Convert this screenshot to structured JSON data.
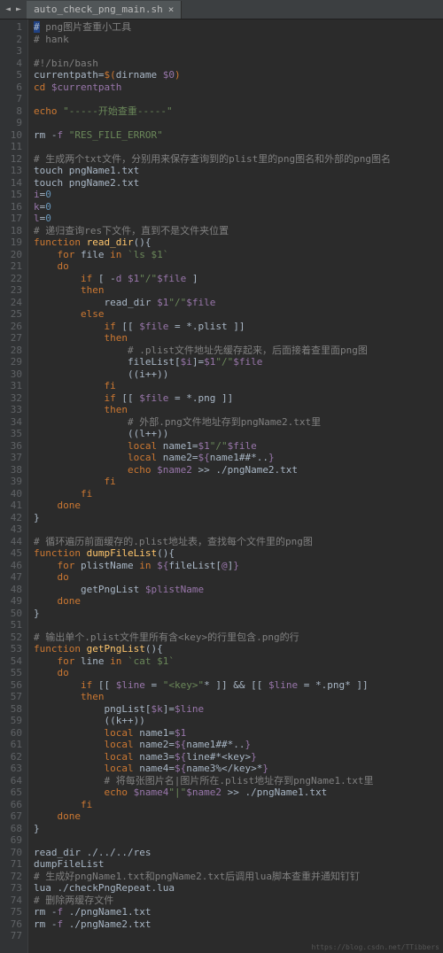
{
  "tab": {
    "name": "auto_check_png_main.sh",
    "close": "×"
  },
  "nav": {
    "left": "◄",
    "right": "►"
  },
  "watermark": "https://blog.csdn.net/TTibbers",
  "lines": [
    {
      "n": 1,
      "seg": [
        {
          "c": "c-hl",
          "t": "#"
        },
        {
          "c": "c-cmt",
          "t": " png图片查重小工具"
        }
      ]
    },
    {
      "n": 2,
      "seg": [
        {
          "c": "c-cmt",
          "t": "# hank"
        }
      ]
    },
    {
      "n": 3,
      "seg": []
    },
    {
      "n": 4,
      "seg": [
        {
          "c": "c-cmt",
          "t": "#!/bin/bash"
        }
      ]
    },
    {
      "n": 5,
      "seg": [
        {
          "c": "",
          "t": "currentpath"
        },
        {
          "c": "c-op",
          "t": "="
        },
        {
          "c": "c-kw",
          "t": "$("
        },
        {
          "c": "",
          "t": "dirname "
        },
        {
          "c": "c-var",
          "t": "$0"
        },
        {
          "c": "c-kw",
          "t": ")"
        }
      ]
    },
    {
      "n": 6,
      "seg": [
        {
          "c": "c-kw",
          "t": "cd "
        },
        {
          "c": "c-var",
          "t": "$currentpath"
        }
      ]
    },
    {
      "n": 7,
      "seg": []
    },
    {
      "n": 8,
      "seg": [
        {
          "c": "c-kw",
          "t": "echo "
        },
        {
          "c": "c-str",
          "t": "\"-----开始查重-----\""
        }
      ]
    },
    {
      "n": 9,
      "seg": []
    },
    {
      "n": 10,
      "seg": [
        {
          "c": "",
          "t": "rm "
        },
        {
          "c": "c-op",
          "t": "-"
        },
        {
          "c": "c-var",
          "t": "f "
        },
        {
          "c": "c-str",
          "t": "\"RES_FILE_ERROR\""
        }
      ]
    },
    {
      "n": 11,
      "seg": []
    },
    {
      "n": 12,
      "seg": [
        {
          "c": "c-cmt",
          "t": "# 生成两个txt文件，分别用来保存查询到的plist里的png图名和外部的png图名"
        }
      ]
    },
    {
      "n": 13,
      "seg": [
        {
          "c": "",
          "t": "touch pngName1.txt"
        }
      ]
    },
    {
      "n": 14,
      "seg": [
        {
          "c": "",
          "t": "touch pngName2.txt"
        }
      ]
    },
    {
      "n": 15,
      "seg": [
        {
          "c": "c-var",
          "t": "i"
        },
        {
          "c": "c-op",
          "t": "="
        },
        {
          "c": "c-num",
          "t": "0"
        }
      ]
    },
    {
      "n": 16,
      "seg": [
        {
          "c": "c-var",
          "t": "k"
        },
        {
          "c": "c-op",
          "t": "="
        },
        {
          "c": "c-num",
          "t": "0"
        }
      ]
    },
    {
      "n": 17,
      "seg": [
        {
          "c": "c-var",
          "t": "l"
        },
        {
          "c": "c-op",
          "t": "="
        },
        {
          "c": "c-num",
          "t": "0"
        }
      ]
    },
    {
      "n": 18,
      "seg": [
        {
          "c": "c-cmt",
          "t": "# 递归查询res下文件，直到不是文件夹位置"
        }
      ]
    },
    {
      "n": 19,
      "seg": [
        {
          "c": "c-kw",
          "t": "function "
        },
        {
          "c": "c-fn",
          "t": "read_dir"
        },
        {
          "c": "",
          "t": "(){"
        }
      ]
    },
    {
      "n": 20,
      "seg": [
        {
          "c": "",
          "t": "    "
        },
        {
          "c": "c-kw",
          "t": "for "
        },
        {
          "c": "",
          "t": "file "
        },
        {
          "c": "c-kw",
          "t": "in "
        },
        {
          "c": "c-str",
          "t": "`ls $1`"
        }
      ]
    },
    {
      "n": 21,
      "seg": [
        {
          "c": "",
          "t": "    "
        },
        {
          "c": "c-kw",
          "t": "do"
        }
      ]
    },
    {
      "n": 22,
      "seg": [
        {
          "c": "",
          "t": "        "
        },
        {
          "c": "c-kw",
          "t": "if "
        },
        {
          "c": "",
          "t": "[ "
        },
        {
          "c": "c-op",
          "t": "-"
        },
        {
          "c": "c-var",
          "t": "d "
        },
        {
          "c": "c-var",
          "t": "$1"
        },
        {
          "c": "c-str",
          "t": "\"/\""
        },
        {
          "c": "c-var",
          "t": "$file"
        },
        {
          "c": "",
          "t": " ]"
        }
      ]
    },
    {
      "n": 23,
      "seg": [
        {
          "c": "",
          "t": "        "
        },
        {
          "c": "c-kw",
          "t": "then"
        }
      ]
    },
    {
      "n": 24,
      "seg": [
        {
          "c": "",
          "t": "            read_dir "
        },
        {
          "c": "c-var",
          "t": "$1"
        },
        {
          "c": "c-str",
          "t": "\"/\""
        },
        {
          "c": "c-var",
          "t": "$file"
        }
      ]
    },
    {
      "n": 25,
      "seg": [
        {
          "c": "",
          "t": "        "
        },
        {
          "c": "c-kw",
          "t": "else"
        }
      ]
    },
    {
      "n": 26,
      "seg": [
        {
          "c": "",
          "t": "            "
        },
        {
          "c": "c-kw",
          "t": "if "
        },
        {
          "c": "",
          "t": "[[ "
        },
        {
          "c": "c-var",
          "t": "$file"
        },
        {
          "c": "",
          "t": " = "
        },
        {
          "c": "c-op",
          "t": "*"
        },
        {
          "c": "",
          "t": ".plist ]]"
        }
      ]
    },
    {
      "n": 27,
      "seg": [
        {
          "c": "",
          "t": "            "
        },
        {
          "c": "c-kw",
          "t": "then"
        }
      ]
    },
    {
      "n": 28,
      "seg": [
        {
          "c": "",
          "t": "                "
        },
        {
          "c": "c-cmt",
          "t": "# .plist文件地址先缓存起来，后面接着查里面png图"
        }
      ]
    },
    {
      "n": 29,
      "seg": [
        {
          "c": "",
          "t": "                fileList["
        },
        {
          "c": "c-var",
          "t": "$i"
        },
        {
          "c": "",
          "t": "]"
        },
        {
          "c": "c-op",
          "t": "="
        },
        {
          "c": "c-var",
          "t": "$1"
        },
        {
          "c": "c-str",
          "t": "\"/\""
        },
        {
          "c": "c-var",
          "t": "$file"
        }
      ]
    },
    {
      "n": 30,
      "seg": [
        {
          "c": "",
          "t": "                ((i"
        },
        {
          "c": "c-op",
          "t": "++"
        },
        {
          "c": "",
          "t": "))"
        }
      ]
    },
    {
      "n": 31,
      "seg": [
        {
          "c": "",
          "t": "            "
        },
        {
          "c": "c-kw",
          "t": "fi"
        }
      ]
    },
    {
      "n": 32,
      "seg": [
        {
          "c": "",
          "t": "            "
        },
        {
          "c": "c-kw",
          "t": "if "
        },
        {
          "c": "",
          "t": "[[ "
        },
        {
          "c": "c-var",
          "t": "$file"
        },
        {
          "c": "",
          "t": " = "
        },
        {
          "c": "c-op",
          "t": "*"
        },
        {
          "c": "",
          "t": ".png ]]"
        }
      ]
    },
    {
      "n": 33,
      "seg": [
        {
          "c": "",
          "t": "            "
        },
        {
          "c": "c-kw",
          "t": "then"
        }
      ]
    },
    {
      "n": 34,
      "seg": [
        {
          "c": "",
          "t": "                "
        },
        {
          "c": "c-cmt",
          "t": "# 外部.png文件地址存到pngName2.txt里"
        }
      ]
    },
    {
      "n": 35,
      "seg": [
        {
          "c": "",
          "t": "                ((l"
        },
        {
          "c": "c-op",
          "t": "++"
        },
        {
          "c": "",
          "t": "))"
        }
      ]
    },
    {
      "n": 36,
      "seg": [
        {
          "c": "",
          "t": "                "
        },
        {
          "c": "c-kw",
          "t": "local "
        },
        {
          "c": "",
          "t": "name1"
        },
        {
          "c": "c-op",
          "t": "="
        },
        {
          "c": "c-var",
          "t": "$1"
        },
        {
          "c": "c-str",
          "t": "\"/\""
        },
        {
          "c": "c-var",
          "t": "$file"
        }
      ]
    },
    {
      "n": 37,
      "seg": [
        {
          "c": "",
          "t": "                "
        },
        {
          "c": "c-kw",
          "t": "local "
        },
        {
          "c": "",
          "t": "name2"
        },
        {
          "c": "c-op",
          "t": "="
        },
        {
          "c": "c-var",
          "t": "${"
        },
        {
          "c": "",
          "t": "name1"
        },
        {
          "c": "c-op",
          "t": "##*"
        },
        {
          "c": "",
          "t": ".."
        },
        {
          "c": "c-var",
          "t": "}"
        }
      ]
    },
    {
      "n": 38,
      "seg": [
        {
          "c": "",
          "t": "                "
        },
        {
          "c": "c-kw",
          "t": "echo "
        },
        {
          "c": "c-var",
          "t": "$name2"
        },
        {
          "c": "",
          "t": " >> ./pngName2.txt"
        }
      ]
    },
    {
      "n": 39,
      "seg": [
        {
          "c": "",
          "t": "            "
        },
        {
          "c": "c-kw",
          "t": "fi"
        }
      ]
    },
    {
      "n": 40,
      "seg": [
        {
          "c": "",
          "t": "        "
        },
        {
          "c": "c-kw",
          "t": "fi"
        }
      ]
    },
    {
      "n": 41,
      "seg": [
        {
          "c": "",
          "t": "    "
        },
        {
          "c": "c-kw",
          "t": "done"
        }
      ]
    },
    {
      "n": 42,
      "seg": [
        {
          "c": "",
          "t": "}"
        }
      ]
    },
    {
      "n": 43,
      "seg": []
    },
    {
      "n": 44,
      "seg": [
        {
          "c": "c-cmt",
          "t": "# 循环遍历前面缓存的.plist地址表，查找每个文件里的png图"
        }
      ]
    },
    {
      "n": 45,
      "seg": [
        {
          "c": "c-kw",
          "t": "function "
        },
        {
          "c": "c-fn",
          "t": "dumpFileList"
        },
        {
          "c": "",
          "t": "(){"
        }
      ]
    },
    {
      "n": 46,
      "seg": [
        {
          "c": "",
          "t": "    "
        },
        {
          "c": "c-kw",
          "t": "for "
        },
        {
          "c": "",
          "t": "plistName "
        },
        {
          "c": "c-kw",
          "t": "in "
        },
        {
          "c": "c-var",
          "t": "${"
        },
        {
          "c": "",
          "t": "fileList["
        },
        {
          "c": "c-var",
          "t": "@"
        },
        {
          "c": "",
          "t": "]"
        },
        {
          "c": "c-var",
          "t": "}"
        }
      ]
    },
    {
      "n": 47,
      "seg": [
        {
          "c": "",
          "t": "    "
        },
        {
          "c": "c-kw",
          "t": "do"
        }
      ]
    },
    {
      "n": 48,
      "seg": [
        {
          "c": "",
          "t": "        getPngList "
        },
        {
          "c": "c-var",
          "t": "$plistName"
        }
      ]
    },
    {
      "n": 49,
      "seg": [
        {
          "c": "",
          "t": "    "
        },
        {
          "c": "c-kw",
          "t": "done"
        }
      ]
    },
    {
      "n": 50,
      "seg": [
        {
          "c": "",
          "t": "}"
        }
      ]
    },
    {
      "n": 51,
      "seg": []
    },
    {
      "n": 52,
      "seg": [
        {
          "c": "c-cmt",
          "t": "# 输出单个.plist文件里所有含<key>的行里包含.png的行"
        }
      ]
    },
    {
      "n": 53,
      "seg": [
        {
          "c": "c-kw",
          "t": "function "
        },
        {
          "c": "c-fn",
          "t": "getPngList"
        },
        {
          "c": "",
          "t": "(){"
        }
      ]
    },
    {
      "n": 54,
      "seg": [
        {
          "c": "",
          "t": "    "
        },
        {
          "c": "c-kw",
          "t": "for "
        },
        {
          "c": "",
          "t": "line "
        },
        {
          "c": "c-kw",
          "t": "in "
        },
        {
          "c": "c-str",
          "t": "`cat $1`"
        }
      ]
    },
    {
      "n": 55,
      "seg": [
        {
          "c": "",
          "t": "    "
        },
        {
          "c": "c-kw",
          "t": "do"
        }
      ]
    },
    {
      "n": 56,
      "seg": [
        {
          "c": "",
          "t": "        "
        },
        {
          "c": "c-kw",
          "t": "if "
        },
        {
          "c": "",
          "t": "[[ "
        },
        {
          "c": "c-var",
          "t": "$line"
        },
        {
          "c": "",
          "t": " = "
        },
        {
          "c": "c-str",
          "t": "\"<key>\""
        },
        {
          "c": "c-op",
          "t": "*"
        },
        {
          "c": "",
          "t": " ]] "
        },
        {
          "c": "c-op",
          "t": "&&"
        },
        {
          "c": "",
          "t": " [[ "
        },
        {
          "c": "c-var",
          "t": "$line"
        },
        {
          "c": "",
          "t": " = "
        },
        {
          "c": "c-op",
          "t": "*"
        },
        {
          "c": "",
          "t": ".png"
        },
        {
          "c": "c-op",
          "t": "*"
        },
        {
          "c": "",
          "t": " ]]"
        }
      ]
    },
    {
      "n": 57,
      "seg": [
        {
          "c": "",
          "t": "        "
        },
        {
          "c": "c-kw",
          "t": "then"
        }
      ]
    },
    {
      "n": 58,
      "seg": [
        {
          "c": "",
          "t": "            pngList["
        },
        {
          "c": "c-var",
          "t": "$k"
        },
        {
          "c": "",
          "t": "]"
        },
        {
          "c": "c-op",
          "t": "="
        },
        {
          "c": "c-var",
          "t": "$line"
        }
      ]
    },
    {
      "n": 59,
      "seg": [
        {
          "c": "",
          "t": "            ((k"
        },
        {
          "c": "c-op",
          "t": "++"
        },
        {
          "c": "",
          "t": "))"
        }
      ]
    },
    {
      "n": 60,
      "seg": [
        {
          "c": "",
          "t": "            "
        },
        {
          "c": "c-kw",
          "t": "local "
        },
        {
          "c": "",
          "t": "name1"
        },
        {
          "c": "c-op",
          "t": "="
        },
        {
          "c": "c-var",
          "t": "$1"
        }
      ]
    },
    {
      "n": 61,
      "seg": [
        {
          "c": "",
          "t": "            "
        },
        {
          "c": "c-kw",
          "t": "local "
        },
        {
          "c": "",
          "t": "name2"
        },
        {
          "c": "c-op",
          "t": "="
        },
        {
          "c": "c-var",
          "t": "${"
        },
        {
          "c": "",
          "t": "name1"
        },
        {
          "c": "c-op",
          "t": "##*"
        },
        {
          "c": "",
          "t": ".."
        },
        {
          "c": "c-var",
          "t": "}"
        }
      ]
    },
    {
      "n": 62,
      "seg": [
        {
          "c": "",
          "t": "            "
        },
        {
          "c": "c-kw",
          "t": "local "
        },
        {
          "c": "",
          "t": "name3"
        },
        {
          "c": "c-op",
          "t": "="
        },
        {
          "c": "c-var",
          "t": "${"
        },
        {
          "c": "",
          "t": "line"
        },
        {
          "c": "c-op",
          "t": "#*"
        },
        {
          "c": "",
          "t": "<key>"
        },
        {
          "c": "c-var",
          "t": "}"
        }
      ]
    },
    {
      "n": 63,
      "seg": [
        {
          "c": "",
          "t": "            "
        },
        {
          "c": "c-kw",
          "t": "local "
        },
        {
          "c": "",
          "t": "name4"
        },
        {
          "c": "c-op",
          "t": "="
        },
        {
          "c": "c-var",
          "t": "${"
        },
        {
          "c": "",
          "t": "name3"
        },
        {
          "c": "c-op",
          "t": "%"
        },
        {
          "c": "",
          "t": "</key>"
        },
        {
          "c": "c-op",
          "t": "*"
        },
        {
          "c": "c-var",
          "t": "}"
        }
      ]
    },
    {
      "n": 64,
      "seg": [
        {
          "c": "",
          "t": "            "
        },
        {
          "c": "c-cmt",
          "t": "# 将每张图片名|图片所在.plist地址存到pngName1.txt里"
        }
      ]
    },
    {
      "n": 65,
      "seg": [
        {
          "c": "",
          "t": "            "
        },
        {
          "c": "c-kw",
          "t": "echo "
        },
        {
          "c": "c-var",
          "t": "$name4"
        },
        {
          "c": "c-str",
          "t": "\"|\""
        },
        {
          "c": "c-var",
          "t": "$name2"
        },
        {
          "c": "",
          "t": " >> ./pngName1.txt"
        }
      ]
    },
    {
      "n": 66,
      "seg": [
        {
          "c": "",
          "t": "        "
        },
        {
          "c": "c-kw",
          "t": "fi"
        }
      ]
    },
    {
      "n": 67,
      "seg": [
        {
          "c": "",
          "t": "    "
        },
        {
          "c": "c-kw",
          "t": "done"
        }
      ]
    },
    {
      "n": 68,
      "seg": [
        {
          "c": "",
          "t": "}"
        }
      ]
    },
    {
      "n": 69,
      "seg": []
    },
    {
      "n": 70,
      "seg": [
        {
          "c": "",
          "t": "read_dir ./../../res"
        }
      ]
    },
    {
      "n": 71,
      "seg": [
        {
          "c": "",
          "t": "dumpFileList"
        }
      ]
    },
    {
      "n": 72,
      "seg": [
        {
          "c": "c-cmt",
          "t": "# 生成好pngName1.txt和pngName2.txt后调用lua脚本查重并通知钉钉"
        }
      ]
    },
    {
      "n": 73,
      "seg": [
        {
          "c": "",
          "t": "lua ./checkPngRepeat.lua"
        }
      ]
    },
    {
      "n": 74,
      "seg": [
        {
          "c": "c-cmt",
          "t": "# 删除两缓存文件"
        }
      ]
    },
    {
      "n": 75,
      "seg": [
        {
          "c": "",
          "t": "rm "
        },
        {
          "c": "c-op",
          "t": "-"
        },
        {
          "c": "c-var",
          "t": "f"
        },
        {
          "c": "",
          "t": " ./pngName1.txt"
        }
      ]
    },
    {
      "n": 76,
      "seg": [
        {
          "c": "",
          "t": "rm "
        },
        {
          "c": "c-op",
          "t": "-"
        },
        {
          "c": "c-var",
          "t": "f"
        },
        {
          "c": "",
          "t": " ./pngName2.txt"
        }
      ]
    },
    {
      "n": 77,
      "seg": []
    }
  ]
}
